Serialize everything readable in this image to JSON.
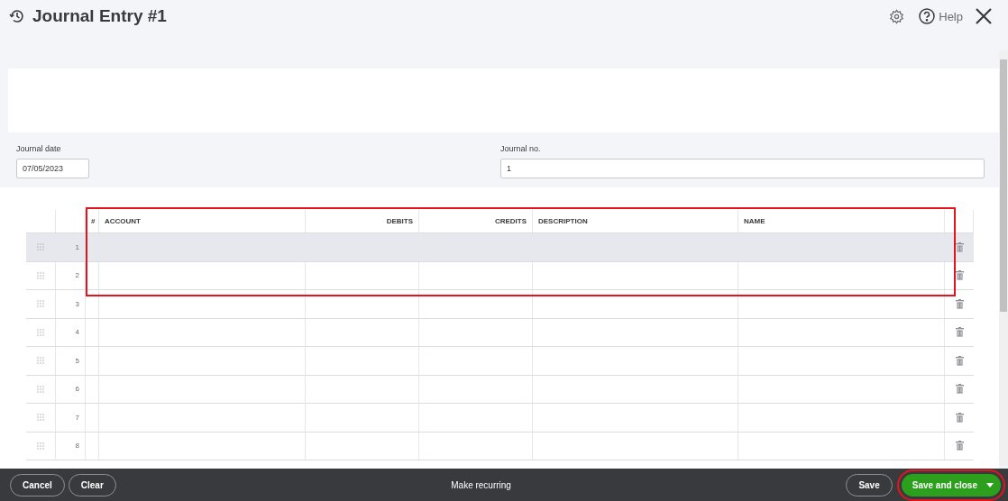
{
  "header": {
    "title": "Journal Entry #1",
    "help": "Help"
  },
  "fields": [
    {
      "label": "Journal date",
      "value": "07/05/2023",
      "kind": "short"
    },
    {
      "label": "Journal no.",
      "value": "1",
      "kind": "wide"
    }
  ],
  "table": {
    "highlighted": true,
    "columns": [
      {
        "label": "#",
        "kind": "text"
      },
      {
        "label": "ACCOUNT",
        "kind": "text"
      },
      {
        "label": "DEBITS",
        "kind": "amount"
      },
      {
        "label": "CREDITS",
        "kind": "amount"
      },
      {
        "label": "DESCRIPTION",
        "kind": "text"
      },
      {
        "label": "NAME",
        "kind": "text"
      }
    ],
    "rows": [
      {
        "number": "1",
        "selected": true
      },
      {
        "number": "2",
        "selected": false
      },
      {
        "number": "3",
        "selected": false
      },
      {
        "number": "4",
        "selected": false
      },
      {
        "number": "5",
        "selected": false
      },
      {
        "number": "6",
        "selected": false
      },
      {
        "number": "7",
        "selected": false
      },
      {
        "number": "8",
        "selected": false
      }
    ]
  },
  "footer": {
    "left_buttons": [
      "Cancel",
      "Clear"
    ],
    "center": "Make recurring",
    "save": "Save",
    "save_and_close": {
      "label": "Save and close",
      "highlighted": true
    }
  }
}
